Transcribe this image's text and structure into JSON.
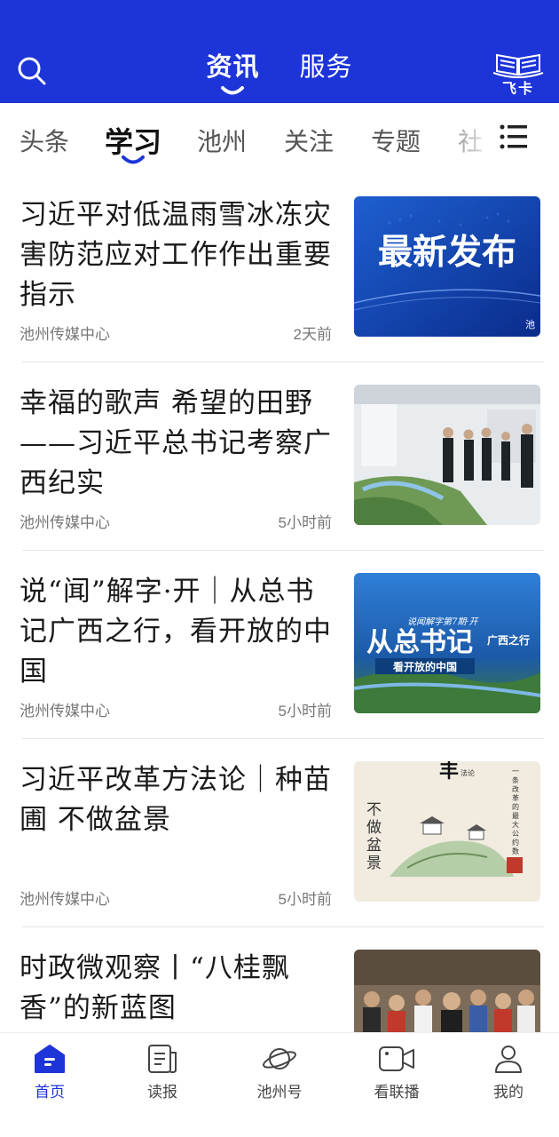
{
  "header": {
    "tabs": [
      {
        "label": "资讯",
        "active": true
      },
      {
        "label": "服务",
        "active": false
      }
    ],
    "logo_text": "飞卡",
    "search_icon": "search-icon",
    "brand_color": "#1d34d8"
  },
  "channels": {
    "items": [
      "头条",
      "学习",
      "池州",
      "关注",
      "专题",
      "社"
    ],
    "active_index": 1,
    "menu_icon": "list-menu-icon"
  },
  "articles": [
    {
      "title": "习近平对低温雨雪冰冻灾害防范应对工作作出重要指示",
      "source": "池州传媒中心",
      "time": "2天前",
      "thumb_text": "最新发布",
      "thumb_corner": "池"
    },
    {
      "title": "幸福的歌声 希望的田野——习近平总书记考察广西纪实",
      "source": "池州传媒中心",
      "time": "5小时前"
    },
    {
      "title": "说“闻”解字·开｜从总书记广西之行，看开放的中国",
      "source": "池州传媒中心",
      "time": "5小时前",
      "thumb_top": "说闻解字第7期·开",
      "thumb_main": "从总书记",
      "thumb_side": "广西之行",
      "thumb_sub": "看开放的中国"
    },
    {
      "title": "习近平改革方法论｜种苗圃 不做盆景",
      "source": "池州传媒中心",
      "time": "5小时前",
      "thumb_vertical": "不做盆景",
      "thumb_right": "一条改革的最大公约数",
      "thumb_top": "法论"
    },
    {
      "title": "时政微观察丨“八桂飘香”的新蓝图",
      "source": "",
      "time": ""
    }
  ],
  "bottom_nav": [
    {
      "label": "首页",
      "icon": "home-icon",
      "active": true
    },
    {
      "label": "读报",
      "icon": "newspaper-icon",
      "active": false
    },
    {
      "label": "池州号",
      "icon": "planet-icon",
      "active": false
    },
    {
      "label": "看联播",
      "icon": "video-camera-icon",
      "active": false
    },
    {
      "label": "我的",
      "icon": "user-icon",
      "active": false
    }
  ]
}
